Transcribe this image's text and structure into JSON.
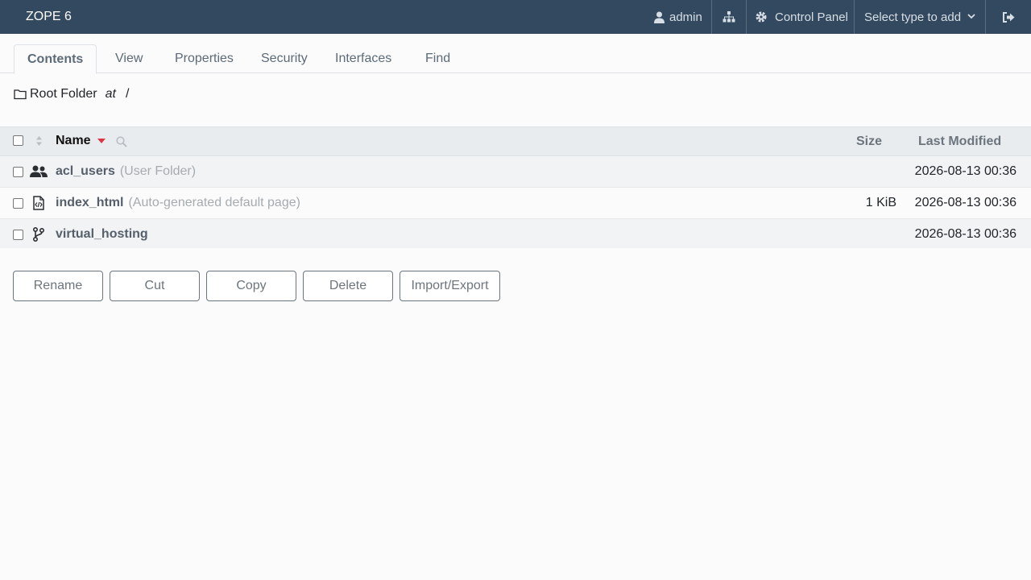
{
  "app": {
    "brand": "ZOPE 6"
  },
  "topbar": {
    "user_label": "admin",
    "control_panel_label": "Control Panel",
    "select_type_placeholder": "Select type to add"
  },
  "tabs": [
    {
      "label": "Contents",
      "active": true
    },
    {
      "label": "View"
    },
    {
      "label": "Properties"
    },
    {
      "label": "Security"
    },
    {
      "label": "Interfaces"
    },
    {
      "label": "Find"
    }
  ],
  "breadcrumb": {
    "folder": "Root Folder",
    "at": "at",
    "path": "/"
  },
  "table": {
    "columns": {
      "name": "Name",
      "size": "Size",
      "modified": "Last Modified"
    },
    "rows": [
      {
        "name": "acl_users",
        "desc": "(User Folder)",
        "size": "",
        "modified": "2026-08-13 00:36",
        "icon": "users-icon"
      },
      {
        "name": "index_html",
        "desc": "(Auto-generated default page)",
        "size": "1 KiB",
        "modified": "2026-08-13 00:36",
        "icon": "file-code-icon"
      },
      {
        "name": "virtual_hosting",
        "desc": "",
        "size": "",
        "modified": "2026-08-13 00:36",
        "icon": "code-branch-icon"
      }
    ]
  },
  "actions": {
    "rename": "Rename",
    "cut": "Cut",
    "copy": "Copy",
    "delete": "Delete",
    "import_export": "Import/Export"
  },
  "colors": {
    "navbar": "#33495f",
    "sort_arrow": "#dc3545"
  }
}
